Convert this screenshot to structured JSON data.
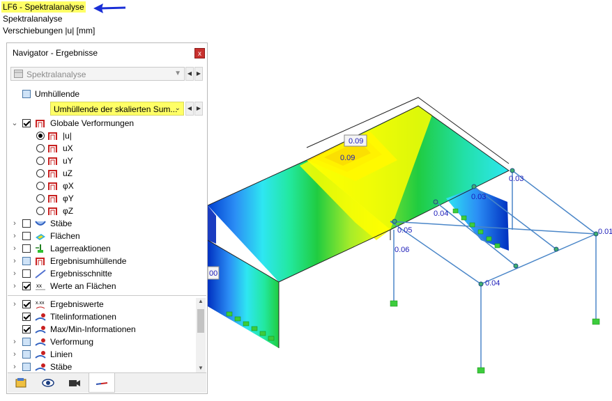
{
  "header": {
    "case_label": "LF6 - Spektralanalyse",
    "analysis_label": "Spektralanalyse",
    "result_label": "Verschiebungen |u| [mm]"
  },
  "navigator": {
    "title": "Navigator - Ergebnisse",
    "close_symbol": "x",
    "case_combo": {
      "value": "Spektralanalyse"
    },
    "envelope_checkbox": {
      "label": "Umhüllende",
      "checked": false
    },
    "envelope_combo": {
      "value": "Umhüllende der skalierten Sum..."
    },
    "tree": [
      {
        "label": "Globale Verformungen",
        "checked": true,
        "expanded": true
      },
      {
        "label": "|u|",
        "radio": true,
        "selected": true
      },
      {
        "label": "uX",
        "radio": true,
        "selected": false
      },
      {
        "label": "uY",
        "radio": true,
        "selected": false
      },
      {
        "label": "uZ",
        "radio": true,
        "selected": false
      },
      {
        "label": "φX",
        "radio": true,
        "selected": false
      },
      {
        "label": "φY",
        "radio": true,
        "selected": false
      },
      {
        "label": "φZ",
        "radio": true,
        "selected": false
      },
      {
        "label": "Stäbe",
        "checked": false
      },
      {
        "label": "Flächen",
        "checked": false
      },
      {
        "label": "Lagerreaktionen",
        "checked": false
      },
      {
        "label": "Ergebnisumhüllende",
        "checked": false
      },
      {
        "label": "Ergebnisschnitte",
        "checked": false
      },
      {
        "label": "Werte an Flächen",
        "checked": true
      }
    ],
    "tree2": [
      {
        "label": "Ergebniswerte",
        "checked": true
      },
      {
        "label": "Titelinformationen",
        "checked": true
      },
      {
        "label": "Max/Min-Informationen",
        "checked": true
      },
      {
        "label": "Verformung",
        "checked": false
      },
      {
        "label": "Linien",
        "checked": false
      },
      {
        "label": "Stäbe",
        "checked": false
      }
    ],
    "tabs": [
      "data-icon",
      "eye-icon",
      "camera-icon",
      "results-icon"
    ]
  },
  "view": {
    "value_labels": [
      "0.09",
      "0.09",
      "0.03",
      "0.03",
      "0.04",
      "0.05",
      "0.06",
      "0.01",
      "0.04",
      "00"
    ]
  },
  "colors": {
    "highlight": "#ffff66",
    "arrow": "#1a2fd6",
    "label_blue": "#1a1ab8"
  }
}
